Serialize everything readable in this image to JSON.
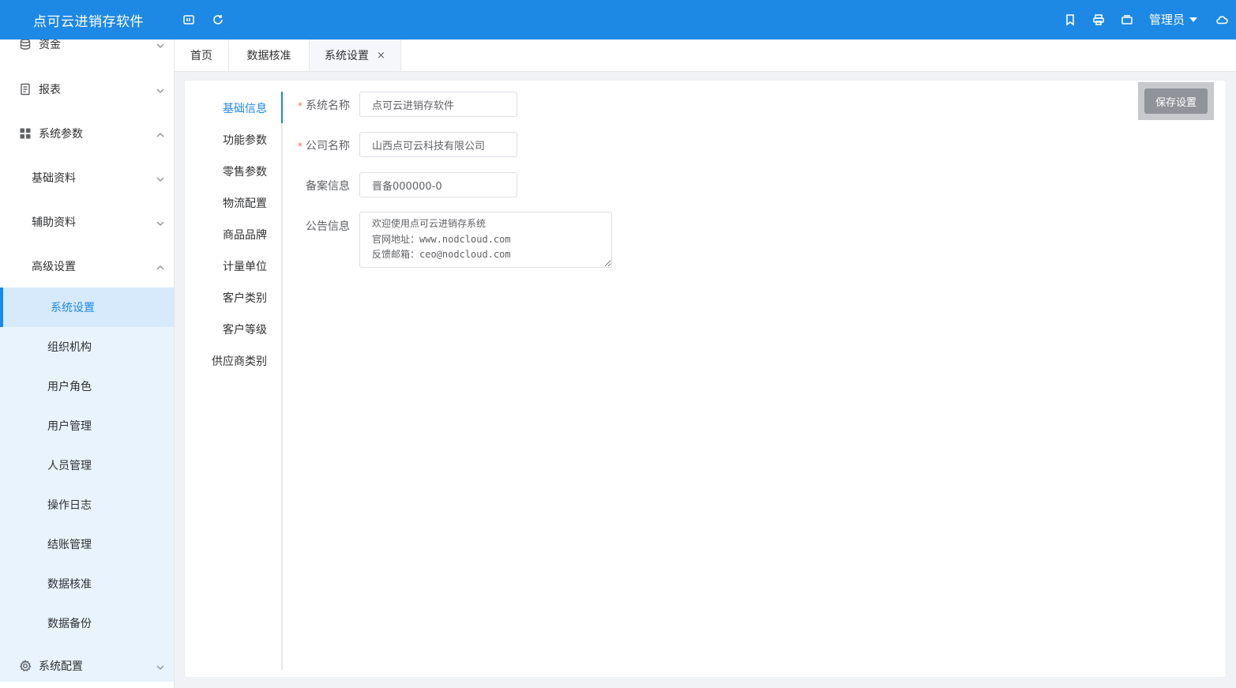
{
  "header": {
    "app_title": "点可云进销存软件",
    "user_name": "管理员"
  },
  "sidebar": {
    "items": [
      {
        "label": "资金",
        "icon": "database-icon"
      },
      {
        "label": "报表",
        "icon": "document-icon"
      },
      {
        "label": "系统参数",
        "icon": "grid-icon"
      },
      {
        "label": "基础资料"
      },
      {
        "label": "辅助资料"
      },
      {
        "label": "高级设置"
      },
      {
        "label": "系统设置"
      },
      {
        "label": "组织机构"
      },
      {
        "label": "用户角色"
      },
      {
        "label": "用户管理"
      },
      {
        "label": "人员管理"
      },
      {
        "label": "操作日志"
      },
      {
        "label": "结账管理"
      },
      {
        "label": "数据核准"
      },
      {
        "label": "数据备份"
      },
      {
        "label": "系统配置",
        "icon": "gear-icon"
      }
    ]
  },
  "tabs": [
    {
      "label": "首页"
    },
    {
      "label": "数据核准"
    },
    {
      "label": "系统设置",
      "close": "×"
    }
  ],
  "settings_nav": [
    "基础信息",
    "功能参数",
    "零售参数",
    "物流配置",
    "商品品牌",
    "计量单位",
    "客户类别",
    "客户等级",
    "供应商类别"
  ],
  "form": {
    "required_mark": "*",
    "system_name_label": "系统名称",
    "system_name_value": "点可云进销存软件",
    "company_name_label": "公司名称",
    "company_name_value": "山西点可云科技有限公司",
    "record_label": "备案信息",
    "record_value": "晋备000000-0",
    "notice_label": "公告信息",
    "notice_value": "欢迎使用点可云进销存系统\n官网地址：www.nodcloud.com\n反馈邮箱：ceo@nodcloud.com",
    "save_label": "保存设置"
  },
  "colors": {
    "primary": "#1e88e5",
    "required": "#f56c6c",
    "save_button": "#909399"
  }
}
